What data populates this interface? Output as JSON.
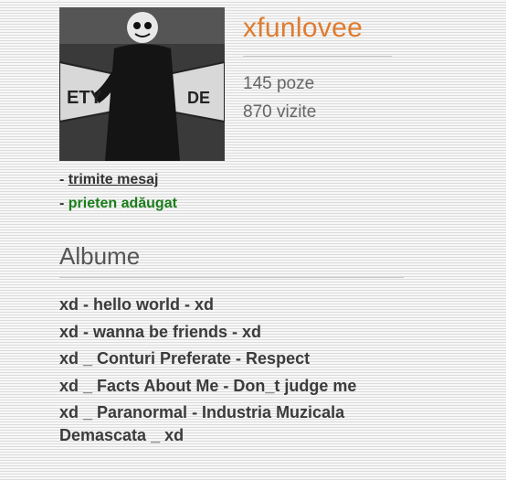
{
  "profile": {
    "username": "xfunlovee",
    "photos_count": "145 poze",
    "visits_count": "870 vizite",
    "avatar_sign_left": "ETY",
    "avatar_sign_right": "DE"
  },
  "actions": {
    "prefix": "- ",
    "send_message": "trimite mesaj",
    "friend_added": "prieten adăugat"
  },
  "albums": {
    "heading": "Albume",
    "items": [
      "xd - hello world - xd",
      "xd - wanna be friends - xd",
      "xd _ Conturi Preferate - Respect",
      "xd _ Facts About Me - Don_t judge me",
      "xd _ Paranormal - Industria Muzicala Demascata _ xd"
    ]
  },
  "colors": {
    "username": "#e07b2e",
    "friend_added": "#1a7e1a",
    "text": "#3b3b3b"
  }
}
